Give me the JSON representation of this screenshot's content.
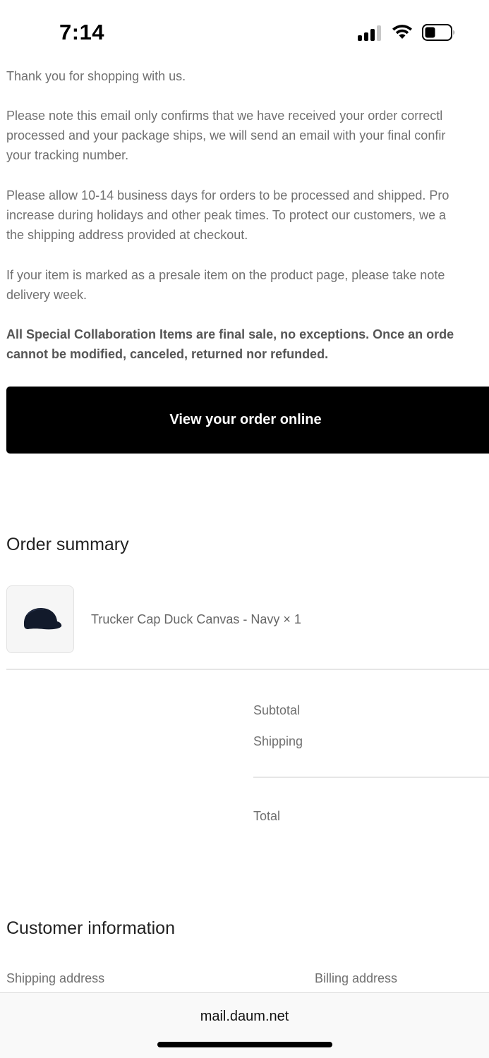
{
  "status_bar": {
    "time": "7:14"
  },
  "email": {
    "paragraphs": [
      [
        "Thank you for shopping with us."
      ],
      [
        "Please note this email only confirms that we have received your order correctl",
        "processed and your package ships, we will send an email with your final confir",
        "your tracking number."
      ],
      [
        "Please allow 10-14 business days for orders to be processed and shipped. Pro",
        "increase during holidays and other peak times. To protect our customers, we a",
        "the shipping address provided at checkout."
      ],
      [
        "If your item is marked as a presale item on the product page, please take note",
        "delivery week."
      ]
    ],
    "notice": [
      "All Special Collaboration Items are final sale, no exceptions. Once an orde",
      "cannot be modified, canceled, returned nor refunded."
    ],
    "view_order_button": "View your order online"
  },
  "order_summary": {
    "title": "Order summary",
    "item": {
      "name": "Trucker Cap Duck Canvas - Navy × 1",
      "thumbnail_icon": "navy-cap-icon"
    },
    "labels": {
      "subtotal": "Subtotal",
      "shipping": "Shipping",
      "total": "Total"
    }
  },
  "customer_information": {
    "title": "Customer information",
    "shipping_address": "Shipping address",
    "billing_address": "Billing address"
  },
  "browser": {
    "url": "mail.daum.net"
  }
}
